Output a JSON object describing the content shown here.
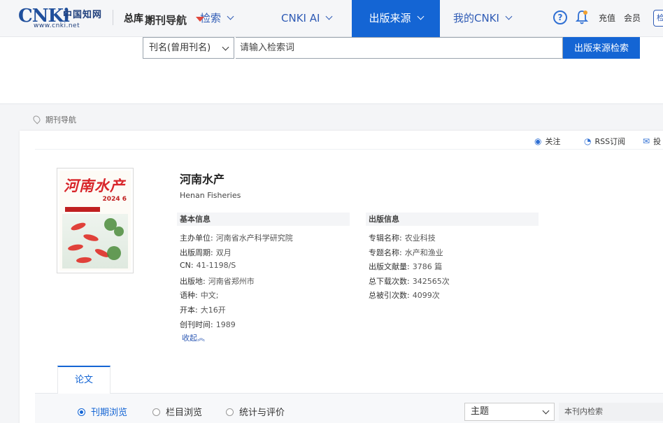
{
  "header": {
    "logo_text": "CNKi",
    "logo_cn": "中国知网",
    "logo_url": "www.cnki.net",
    "library": "总库",
    "nav": [
      {
        "label": "检索",
        "active": false
      },
      {
        "label": "CNKI AI",
        "active": false
      },
      {
        "label": "出版来源",
        "active": true
      },
      {
        "label": "我的CNKI",
        "active": false
      }
    ],
    "help_icon": "?",
    "recharge": "充值",
    "member": "会员",
    "cut_button": "检"
  },
  "search": {
    "nav_title": "期刊导航",
    "field_select": "刊名(曾用刊名)",
    "placeholder": "请输入检索词",
    "button": "出版来源检索"
  },
  "breadcrumb": "期刊导航",
  "actions": {
    "follow": "关注",
    "rss": "RSS订阅",
    "cut": "投"
  },
  "journal": {
    "title": "河南水产",
    "title_en": "Henan Fisheries",
    "cover_title": "河南水产",
    "cover_issue": "2024 6",
    "basic_header": "基本信息",
    "publish_header": "出版信息",
    "basic": [
      {
        "k": "主办单位:",
        "v": "河南省水产科学研究院"
      },
      {
        "k": "出版周期:",
        "v": "双月"
      },
      {
        "k": "CN:",
        "v": "41-1198/S"
      },
      {
        "k": "出版地:",
        "v": "河南省郑州市"
      },
      {
        "k": "语种:",
        "v": "中文;"
      },
      {
        "k": "开本:",
        "v": "大16开"
      },
      {
        "k": "创刊时间:",
        "v": "1989"
      }
    ],
    "publish": [
      {
        "k": "专辑名称:",
        "v": "农业科技"
      },
      {
        "k": "专题名称:",
        "v": "水产和渔业"
      },
      {
        "k": "出版文献量:",
        "v": "3786 篇"
      },
      {
        "k": "总下载次数:",
        "v": "342565次"
      },
      {
        "k": "总被引次数:",
        "v": "4099次"
      }
    ],
    "collapse": "收起︽"
  },
  "tabs": {
    "paper": "论文"
  },
  "browse": {
    "options": [
      {
        "label": "刊期浏览",
        "selected": true
      },
      {
        "label": "栏目浏览",
        "selected": false
      },
      {
        "label": "统计与评价",
        "selected": false
      }
    ],
    "field": "主题",
    "inner_search": "本刊内检索"
  },
  "colors": {
    "brand_blue": "#1465d4",
    "link_blue": "#2f5bb5",
    "alert_red": "#e0483c"
  }
}
